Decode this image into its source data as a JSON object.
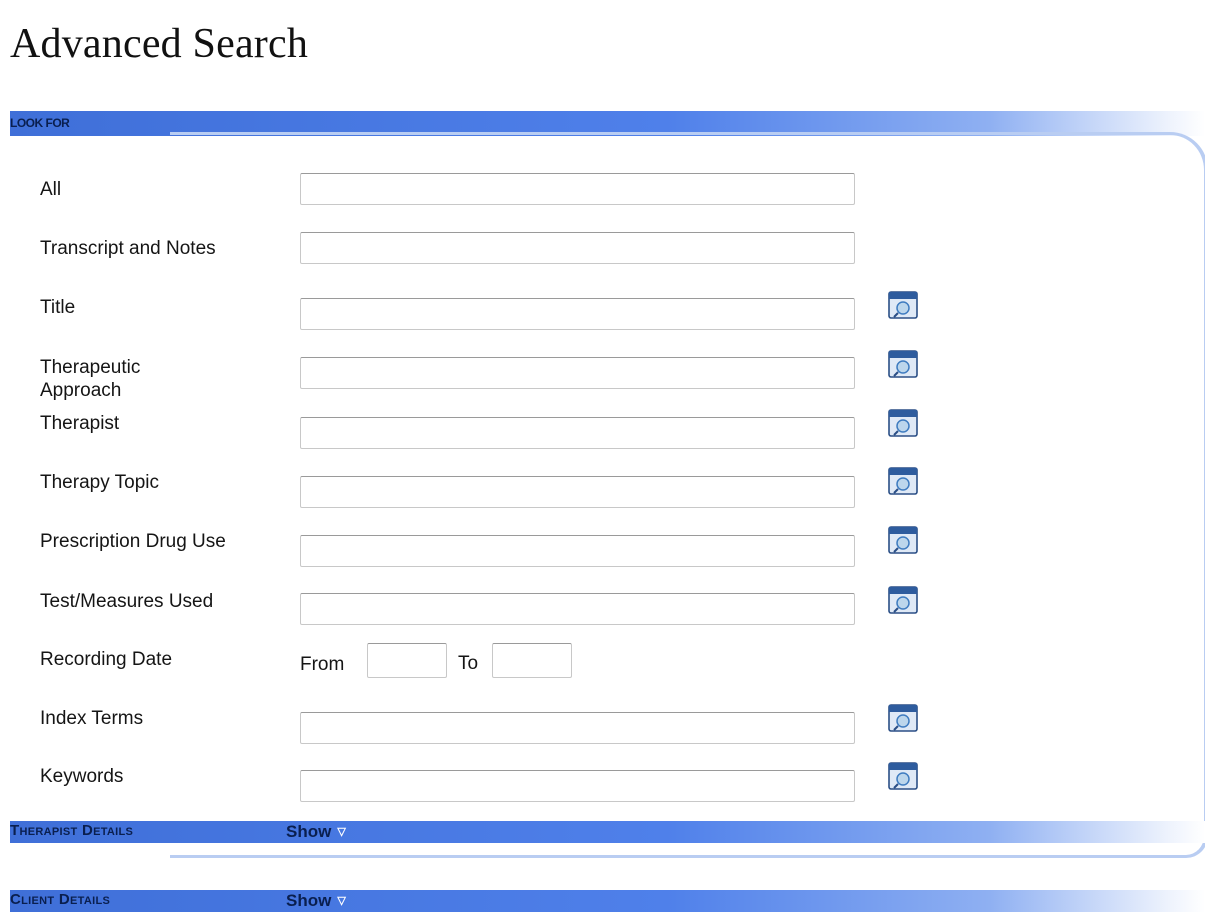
{
  "page": {
    "title": "Advanced Search"
  },
  "sections": {
    "look_for": "LOOK FOR",
    "therapist_details": "Therapist Details",
    "client_details": "Client Details",
    "show_label": "Show"
  },
  "fields": [
    {
      "label": "All",
      "value": "",
      "lookup": false
    },
    {
      "label": "Transcript and Notes",
      "value": "",
      "lookup": false
    },
    {
      "label": "Title",
      "value": "",
      "lookup": true
    },
    {
      "label": "Therapeutic Approach",
      "value": "",
      "lookup": true
    },
    {
      "label": "Therapist",
      "value": "",
      "lookup": true
    },
    {
      "label": "Therapy Topic",
      "value": "",
      "lookup": true
    },
    {
      "label": "Prescription Drug Use",
      "value": "",
      "lookup": true
    },
    {
      "label": "Test/Measures Used",
      "value": "",
      "lookup": true
    },
    {
      "label": "Index Terms",
      "value": "",
      "lookup": true
    },
    {
      "label": "Keywords",
      "value": "",
      "lookup": true
    }
  ],
  "recording_date": {
    "label": "Recording Date",
    "from_label": "From",
    "to_label": "To",
    "from_value": "",
    "to_value": ""
  },
  "icons": {
    "lookup": "lookup-list-icon",
    "show_caret": "triangle-down-icon"
  },
  "colors": {
    "band": "#4f80ea",
    "band_text": "#0a1f4f",
    "panel_border": "#b9cdf2"
  }
}
